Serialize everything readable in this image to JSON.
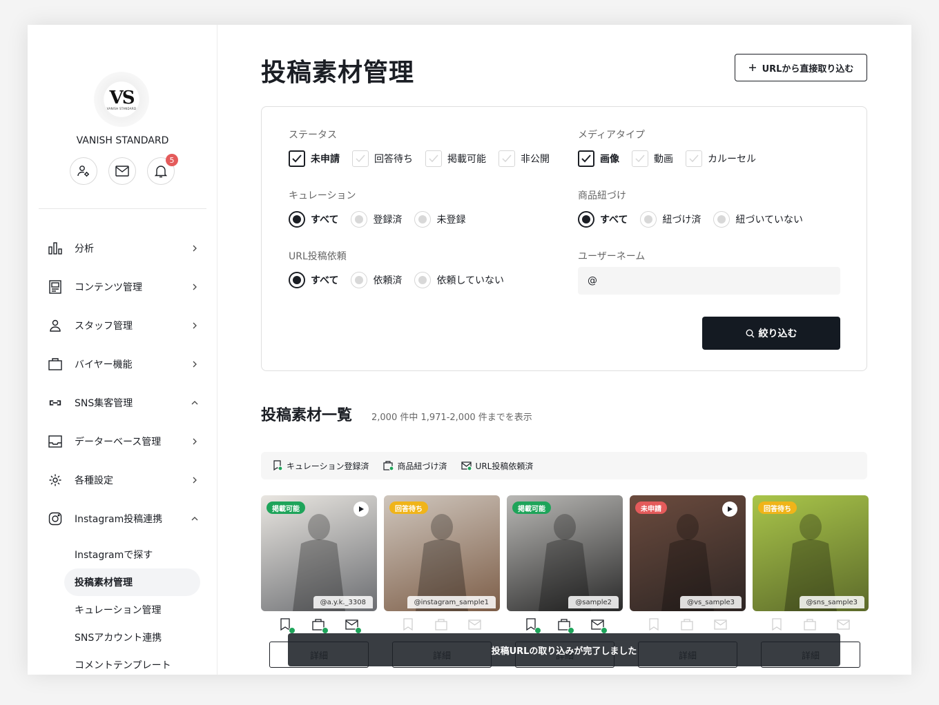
{
  "brand": {
    "logo_mark": "VS",
    "logo_sub": "VANISH STANDARD",
    "name": "VANISH STANDARD",
    "notification_count": "5"
  },
  "nav": {
    "items": [
      {
        "label": "分析",
        "icon": "bar-chart-icon",
        "chevron": "right"
      },
      {
        "label": "コンテンツ管理",
        "icon": "content-icon",
        "chevron": "right"
      },
      {
        "label": "スタッフ管理",
        "icon": "person-icon",
        "chevron": "right"
      },
      {
        "label": "バイヤー機能",
        "icon": "bag-icon",
        "chevron": "right"
      },
      {
        "label": "SNS集客管理",
        "icon": "link-icon",
        "chevron": "up"
      },
      {
        "label": "データーベース管理",
        "icon": "inbox-icon",
        "chevron": "right"
      },
      {
        "label": "各種設定",
        "icon": "gear-icon",
        "chevron": "right"
      },
      {
        "label": "Instagram投稿連携",
        "icon": "instagram-icon",
        "chevron": "up"
      }
    ],
    "sub_items": [
      {
        "label": "Instagramで探す"
      },
      {
        "label": "投稿素材管理",
        "active": true
      },
      {
        "label": "キュレーション管理"
      },
      {
        "label": "SNSアカウント連携"
      },
      {
        "label": "コメントテンプレート"
      }
    ]
  },
  "page": {
    "title": "投稿素材管理",
    "url_import_label": "URLから直接取り込む"
  },
  "filters": {
    "status": {
      "label": "ステータス",
      "options": [
        {
          "label": "未申請",
          "checked": true
        },
        {
          "label": "回答待ち",
          "checked": false
        },
        {
          "label": "掲載可能",
          "checked": false
        },
        {
          "label": "非公開",
          "checked": false
        }
      ]
    },
    "media_type": {
      "label": "メディアタイプ",
      "options": [
        {
          "label": "画像",
          "checked": true
        },
        {
          "label": "動画",
          "checked": false
        },
        {
          "label": "カルーセル",
          "checked": false
        }
      ]
    },
    "curation": {
      "label": "キュレーション",
      "options": [
        {
          "label": "すべて",
          "selected": true
        },
        {
          "label": "登録済",
          "selected": false
        },
        {
          "label": "未登録",
          "selected": false
        }
      ]
    },
    "product_link": {
      "label": "商品紐づけ",
      "options": [
        {
          "label": "すべて",
          "selected": true
        },
        {
          "label": "紐づけ済",
          "selected": false
        },
        {
          "label": "紐づいていない",
          "selected": false
        }
      ]
    },
    "url_request": {
      "label": "URL投稿依頼",
      "options": [
        {
          "label": "すべて",
          "selected": true
        },
        {
          "label": "依頼済",
          "selected": false
        },
        {
          "label": "依頼していない",
          "selected": false
        }
      ]
    },
    "username": {
      "label": "ユーザーネーム",
      "value": "@"
    },
    "submit_label": "絞り込む"
  },
  "list": {
    "title": "投稿素材一覧",
    "count_text": "2,000 件中 1,971-2,000 件までを表示",
    "legend": {
      "curation": "キュレーション登録済",
      "product": "商品紐づけ済",
      "url": "URL投稿依頼済"
    },
    "detail_label": "詳細",
    "cards": [
      {
        "tag": "掲載可能",
        "tag_color": "#1ea45a",
        "video": true,
        "handle": "@a.y.k._3308",
        "curation": true,
        "product": true,
        "url": true,
        "bg": [
          "#e9e6e1",
          "#6c6e72"
        ]
      },
      {
        "tag": "回答待ち",
        "tag_color": "#f0b419",
        "video": false,
        "handle": "@instagram_sample1",
        "curation": false,
        "product": false,
        "url": false,
        "bg": [
          "#cfc6bd",
          "#7d5e48"
        ]
      },
      {
        "tag": "掲載可能",
        "tag_color": "#1ea45a",
        "video": false,
        "handle": "@sample2",
        "curation": true,
        "product": true,
        "url": true,
        "bg": [
          "#b9b8b5",
          "#2a2a2a"
        ]
      },
      {
        "tag": "未申請",
        "tag_color": "#e45b5b",
        "video": true,
        "handle": "@vs_sample3",
        "curation": false,
        "product": false,
        "url": false,
        "bg": [
          "#6b4b3e",
          "#2e2624"
        ]
      },
      {
        "tag": "回答待ち",
        "tag_color": "#f0b419",
        "video": false,
        "handle": "@sns_sample3",
        "curation": false,
        "product": false,
        "url": false,
        "bg": [
          "#a9c54a",
          "#5c6a2a"
        ]
      }
    ]
  },
  "toast": {
    "message": "投稿URLの取り込みが完了しました"
  }
}
